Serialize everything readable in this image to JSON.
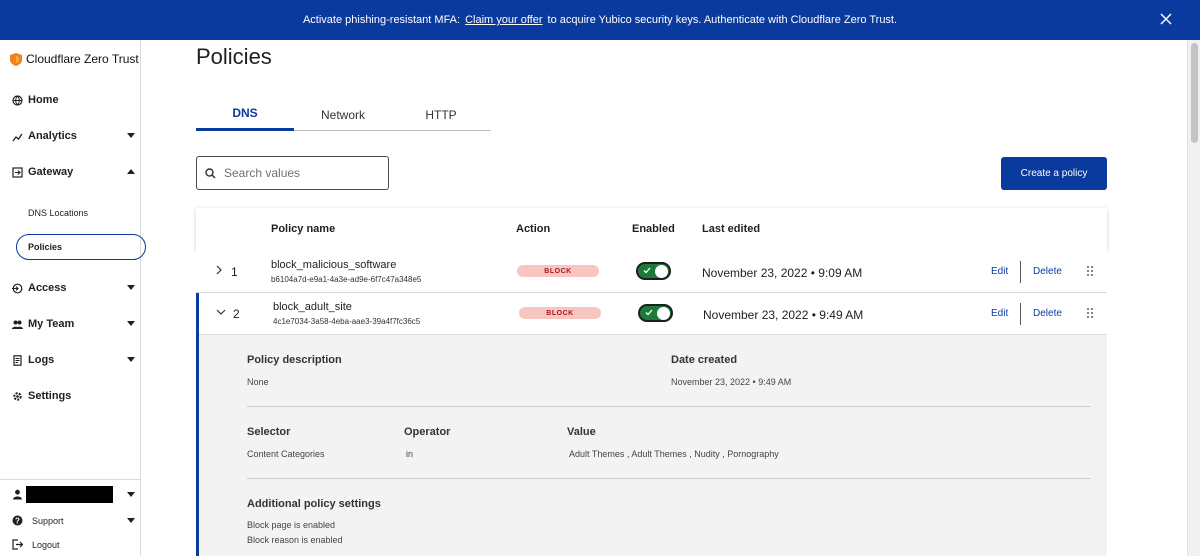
{
  "banner": {
    "text_before": "Activate phishing-resistant MFA:",
    "link": "Claim your offer",
    "text_after": "to acquire Yubico security keys. Authenticate with Cloudflare Zero Trust."
  },
  "sidebar": {
    "brand": "Cloudflare Zero Trust",
    "items": {
      "home": "Home",
      "analytics": "Analytics",
      "gateway": "Gateway",
      "dns_locations": "DNS Locations",
      "policies": "Policies",
      "access": "Access",
      "my_team": "My Team",
      "logs": "Logs",
      "settings": "Settings"
    },
    "bottom": {
      "support": "Support",
      "logout": "Logout"
    }
  },
  "page": {
    "title": "Policies",
    "tabs": [
      "DNS",
      "Network",
      "HTTP"
    ],
    "active_tab": "DNS",
    "search_placeholder": "Search values",
    "create_button": "Create a policy"
  },
  "table": {
    "headers": {
      "name": "Policy name",
      "action": "Action",
      "enabled": "Enabled",
      "last_edited": "Last edited"
    },
    "rows": [
      {
        "num": "1",
        "name": "block_malicious_software",
        "id": "b6104a7d-e9a1-4a3e-ad9e-6f7c47a348e5",
        "action": "BLOCK",
        "enabled": true,
        "edited": "November 23, 2022 • 9:09 AM",
        "edit": "Edit",
        "delete": "Delete"
      },
      {
        "num": "2",
        "name": "block_adult_site",
        "id": "4c1e7034-3a58-4eba-aae3-39a4f7fc36c5",
        "action": "BLOCK",
        "enabled": true,
        "edited": "November 23, 2022 • 9:49 AM",
        "edit": "Edit",
        "delete": "Delete"
      }
    ]
  },
  "details": {
    "description_label": "Policy description",
    "description_value": "None",
    "created_label": "Date created",
    "created_value": "November 23, 2022 • 9:49 AM",
    "selector_label": "Selector",
    "selector_value": "Content Categories",
    "operator_label": "Operator",
    "operator_value": "in",
    "value_label": "Value",
    "value_value": "Adult Themes , Adult Themes , Nudity , Pornography",
    "additional_label": "Additional policy settings",
    "additional_line1": "Block page is enabled",
    "additional_line2": "Block reason is enabled"
  },
  "colors": {
    "brand_blue": "#0a3a9e",
    "block_bg": "#f7c6c3",
    "block_text": "#b1131b",
    "toggle_on": "#1e7a3b"
  }
}
